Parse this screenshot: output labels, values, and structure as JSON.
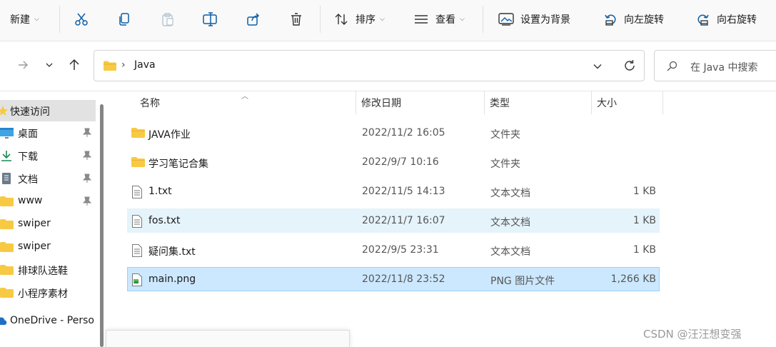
{
  "toolbar": {
    "new_label": "新建",
    "sort_label": "排序",
    "view_label": "查看",
    "set_background_label": "设置为背景",
    "rotate_left_label": "向左旋转",
    "rotate_right_label": "向右旋转"
  },
  "address": {
    "path": "Java",
    "separator": "›"
  },
  "search": {
    "placeholder": "在 Java 中搜索"
  },
  "sidebar": {
    "items": [
      {
        "label": "快速访问",
        "icon": "star-icon"
      },
      {
        "label": "桌面",
        "icon": "desktop-icon"
      },
      {
        "label": "下载",
        "icon": "download-icon"
      },
      {
        "label": "文档",
        "icon": "document-icon"
      },
      {
        "label": "www",
        "icon": "folder-icon"
      },
      {
        "label": "swiper",
        "icon": "folder-icon"
      },
      {
        "label": "swiper",
        "icon": "folder-icon"
      },
      {
        "label": "排球队选鞋",
        "icon": "folder-icon"
      },
      {
        "label": "小程序素材",
        "icon": "folder-icon"
      },
      {
        "label": "OneDrive - Perso",
        "icon": "cloud-icon"
      }
    ]
  },
  "columns": {
    "name": "名称",
    "modified": "修改日期",
    "type": "类型",
    "size": "大小"
  },
  "files": [
    {
      "name": "JAVA作业",
      "modified": "2022/11/2 16:05",
      "type": "文件夹",
      "size": "",
      "icon": "folder-icon"
    },
    {
      "name": "学习笔记合集",
      "modified": "2022/9/7 10:16",
      "type": "文件夹",
      "size": "",
      "icon": "folder-icon"
    },
    {
      "name": "1.txt",
      "modified": "2022/11/5 14:13",
      "type": "文本文档",
      "size": "1 KB",
      "icon": "text-file-icon"
    },
    {
      "name": "fos.txt",
      "modified": "2022/11/7 16:07",
      "type": "文本文档",
      "size": "1 KB",
      "icon": "text-file-icon"
    },
    {
      "name": "疑问集.txt",
      "modified": "2022/9/5 23:31",
      "type": "文本文档",
      "size": "1 KB",
      "icon": "text-file-icon"
    },
    {
      "name": "main.png",
      "modified": "2022/11/8 23:52",
      "type": "PNG 图片文件",
      "size": "1,266 KB",
      "icon": "image-file-icon"
    }
  ],
  "watermark": "CSDN @汪汪想变强",
  "colors": {
    "folder": "#f8c943",
    "selected_row": "#cce8ff",
    "hover_row": "#e5f3fb",
    "accent_icon": "#0a5ea8"
  }
}
